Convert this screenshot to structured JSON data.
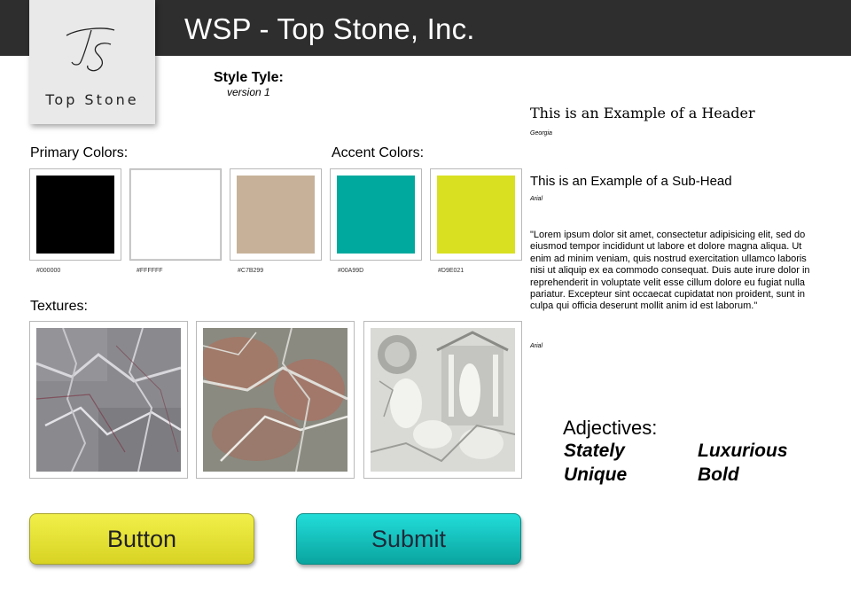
{
  "app": {
    "title": "WSP - Top Stone, Inc."
  },
  "logo": {
    "monogram": "TS",
    "name": "Top Stone"
  },
  "style_tile": {
    "title": "Style Tyle:",
    "version": "version 1"
  },
  "primary_colors": {
    "label": "Primary Colors:",
    "swatches": [
      {
        "hex": "#000000",
        "color": "#000000"
      },
      {
        "hex": "#FFFFFF",
        "color": "#FFFFFF"
      },
      {
        "hex": "#C7B299",
        "color": "#C7B299"
      }
    ]
  },
  "accent_colors": {
    "label": "Accent Colors:",
    "swatches": [
      {
        "hex": "#00A99D",
        "color": "#00A99D"
      },
      {
        "hex": "#D9E021",
        "color": "#D9E021"
      }
    ]
  },
  "textures": {
    "label": "Textures:",
    "items": [
      "grey-marble",
      "red-marble",
      "white-stone-relief"
    ]
  },
  "buttons": {
    "primary": "Button",
    "submit": "Submit"
  },
  "typography": {
    "header_example": "This is an Example of a Header",
    "header_font": "Georgia",
    "subhead_example": "This is an Example of a Sub-Head",
    "subhead_font": "Arial",
    "body_example": "\"Lorem ipsum dolor sit amet, consectetur adipisicing elit, sed do eiusmod tempor incididunt ut labore et dolore magna aliqua. Ut enim ad minim veniam, quis nostrud exercitation ullamco laboris nisi ut aliquip ex ea commodo consequat. Duis aute irure dolor in reprehenderit in voluptate velit esse cillum dolore eu fugiat nulla pariatur. Excepteur sint occaecat cupidatat non proident, sunt in culpa qui officia deserunt mollit anim id est laborum.\"",
    "body_font": "Arial"
  },
  "adjectives": {
    "label": "Adjectives:",
    "words": [
      "Stately",
      "Luxurious",
      "Unique",
      "Bold"
    ]
  }
}
